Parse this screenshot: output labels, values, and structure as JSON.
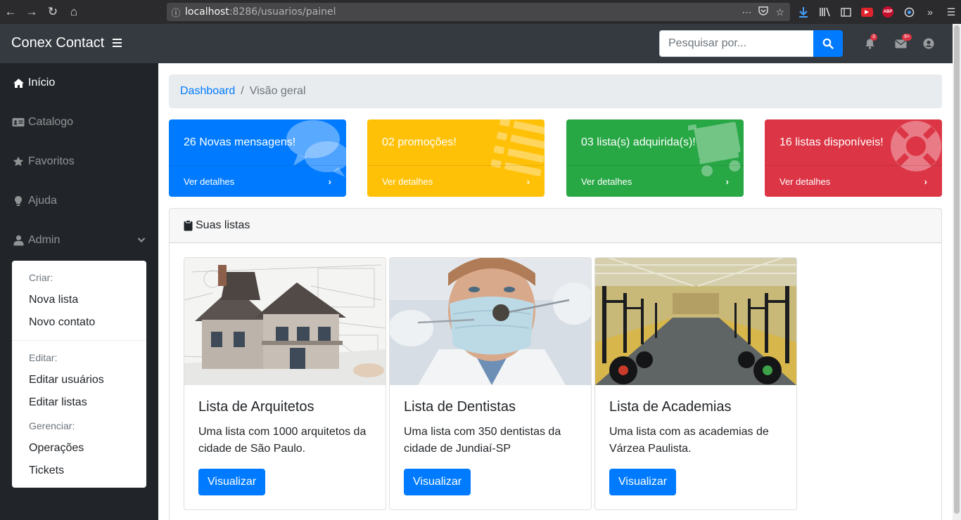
{
  "browser": {
    "url_host": "localhost",
    "url_rest": ":8286/usuarios/painel",
    "extension_badge": "ABP"
  },
  "topbar": {
    "brand": "Conex Contact",
    "search_placeholder": "Pesquisar por...",
    "notifications_count": "3",
    "messages_count": "9+"
  },
  "sidebar": {
    "items": [
      {
        "label": "Início",
        "icon": "home-icon"
      },
      {
        "label": "Catalogo",
        "icon": "id-card-icon"
      },
      {
        "label": "Favoritos",
        "icon": "star-icon"
      },
      {
        "label": "Ajuda",
        "icon": "lightbulb-icon"
      },
      {
        "label": "Admin",
        "icon": "user-icon"
      }
    ],
    "admin_menu": {
      "create_header": "Criar:",
      "new_list": "Nova lista",
      "new_contact": "Novo contato",
      "edit_header": "Editar:",
      "edit_users": "Editar usuários",
      "edit_lists": "Editar listas",
      "manage_header": "Gerenciar:",
      "operations": "Operações",
      "tickets": "Tickets"
    }
  },
  "breadcrumb": {
    "root": "Dashboard",
    "separator": "/",
    "current": "Visão geral"
  },
  "stats": [
    {
      "title": "26 Novas mensagens!",
      "link": "Ver detalhes",
      "color": "#007bff",
      "icon": "comments-icon"
    },
    {
      "title": "02 promoções!",
      "link": "Ver detalhes",
      "color": "#ffc107",
      "icon": "list-icon"
    },
    {
      "title": "03 lista(s) adquirida(s)!",
      "link": "Ver detalhes",
      "color": "#28a745",
      "icon": "shopping-cart-icon"
    },
    {
      "title": "16 listas disponíveis!",
      "link": "Ver detalhes",
      "color": "#dc3545",
      "icon": "life-ring-icon"
    }
  ],
  "lists_panel": {
    "title": "Suas listas",
    "cards": [
      {
        "title": "Lista de Arquitetos",
        "text": "Uma lista com 1000 arquitetos da cidade de São Paulo.",
        "button": "Visualizar",
        "image": "house-blueprint-image"
      },
      {
        "title": "Lista de Dentistas",
        "text": "Uma lista com 350 dentistas da cidade de Jundiaí-SP",
        "button": "Visualizar",
        "image": "dentist-image"
      },
      {
        "title": "Lista de Academias",
        "text": "Uma lista com as academias de Várzea Paulista.",
        "button": "Visualizar",
        "image": "gym-image"
      }
    ]
  }
}
